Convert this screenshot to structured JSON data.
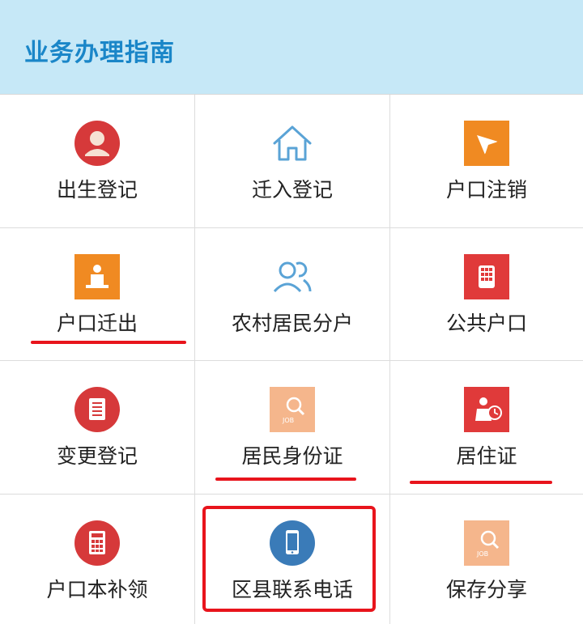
{
  "header": {
    "title": "业务办理指南"
  },
  "items": [
    {
      "label": "出生登记",
      "icon": "person-avatar-icon"
    },
    {
      "label": "迁入登记",
      "icon": "home-icon"
    },
    {
      "label": "户口注销",
      "icon": "paper-plane-icon"
    },
    {
      "label": "户口迁出",
      "icon": "mover-person-icon"
    },
    {
      "label": "农村居民分户",
      "icon": "people-icon"
    },
    {
      "label": "公共户口",
      "icon": "keypad-icon"
    },
    {
      "label": "变更登记",
      "icon": "document-icon"
    },
    {
      "label": "居民身份证",
      "icon": "job-search-icon"
    },
    {
      "label": "居住证",
      "icon": "person-clock-icon"
    },
    {
      "label": "户口本补领",
      "icon": "calculator-icon"
    },
    {
      "label": "区县联系电话",
      "icon": "mobile-phone-icon"
    },
    {
      "label": "保存分享",
      "icon": "job-search-icon"
    }
  ],
  "icon_text": {
    "job": "JOB"
  },
  "colors": {
    "header_bg": "#c6e8f7",
    "header_text": "#1a86c8",
    "red_circle": "#d6393a",
    "orange_square": "#f08a22",
    "light_orange_square": "#f5b68c",
    "red_square": "#e03a3a",
    "blue_outline": "#5aa3d6",
    "annotation_red": "#e8141c"
  }
}
